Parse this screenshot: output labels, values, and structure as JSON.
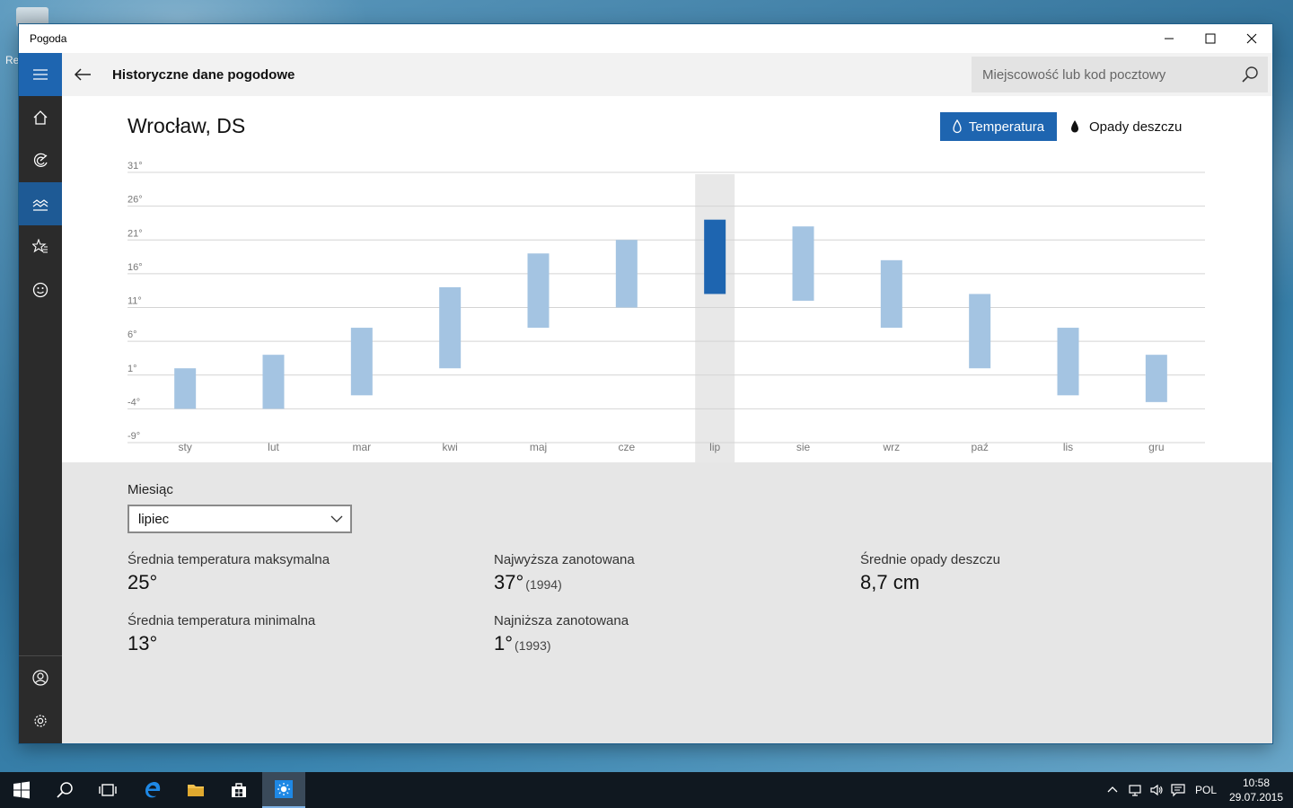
{
  "desktop": {
    "icon_label": "Re"
  },
  "window": {
    "title": "Pogoda"
  },
  "header": {
    "page_title": "Historyczne dane pogodowe",
    "search_placeholder": "Miejscowość lub kod pocztowy"
  },
  "nav": {
    "items": [
      "menu-icon",
      "home-icon",
      "radar-icon",
      "historical-chart-icon",
      "favorites-icon",
      "smiley-icon"
    ],
    "bottom": [
      "account-icon",
      "gear-icon"
    ],
    "active_item": "historical-chart-icon"
  },
  "location": {
    "city": "Wrocław, DS"
  },
  "toggles": {
    "temperature": "Temperatura",
    "rain": "Opady deszczu",
    "selected": "temperature"
  },
  "colors": {
    "accent": "#1e65b0",
    "bar": "#a4c4e2",
    "bar_selected": "#1e65b0",
    "selected_column": "#e8e8e8"
  },
  "chart_data": {
    "type": "bar",
    "subtype": "floating-range",
    "categories": [
      "sty",
      "lut",
      "mar",
      "kwi",
      "maj",
      "cze",
      "lip",
      "sie",
      "wrz",
      "paź",
      "lis",
      "gru"
    ],
    "series": [
      {
        "name": "min",
        "values": [
          -4,
          -4,
          -2,
          2,
          8,
          11,
          13,
          12,
          8,
          2,
          -2,
          -3
        ]
      },
      {
        "name": "max",
        "values": [
          2,
          4,
          8,
          14,
          19,
          21,
          24,
          23,
          18,
          13,
          8,
          4
        ]
      }
    ],
    "selected_category": "lip",
    "yticks": [
      "31°",
      "26°",
      "21°",
      "16°",
      "11°",
      "6°",
      "1°",
      "-4°",
      "-9°"
    ],
    "ylim": [
      -9,
      31
    ],
    "grid": true
  },
  "details": {
    "month_label": "Miesiąc",
    "month_selected": "lipiec",
    "avg_max_label": "Średnia temperatura maksymalna",
    "avg_max_value": "25°",
    "avg_min_label": "Średnia temperatura minimalna",
    "avg_min_value": "13°",
    "highest_label": "Najwyższa zanotowana",
    "highest_value": "37°",
    "highest_year": "(1994)",
    "lowest_label": "Najniższa zanotowana",
    "lowest_value": "1°",
    "lowest_year": "(1993)",
    "rain_label": "Średnie opady deszczu",
    "rain_value": "8,7 cm"
  },
  "taskbar": {
    "language": "POL",
    "time": "10:58",
    "date": "29.07.2015"
  }
}
